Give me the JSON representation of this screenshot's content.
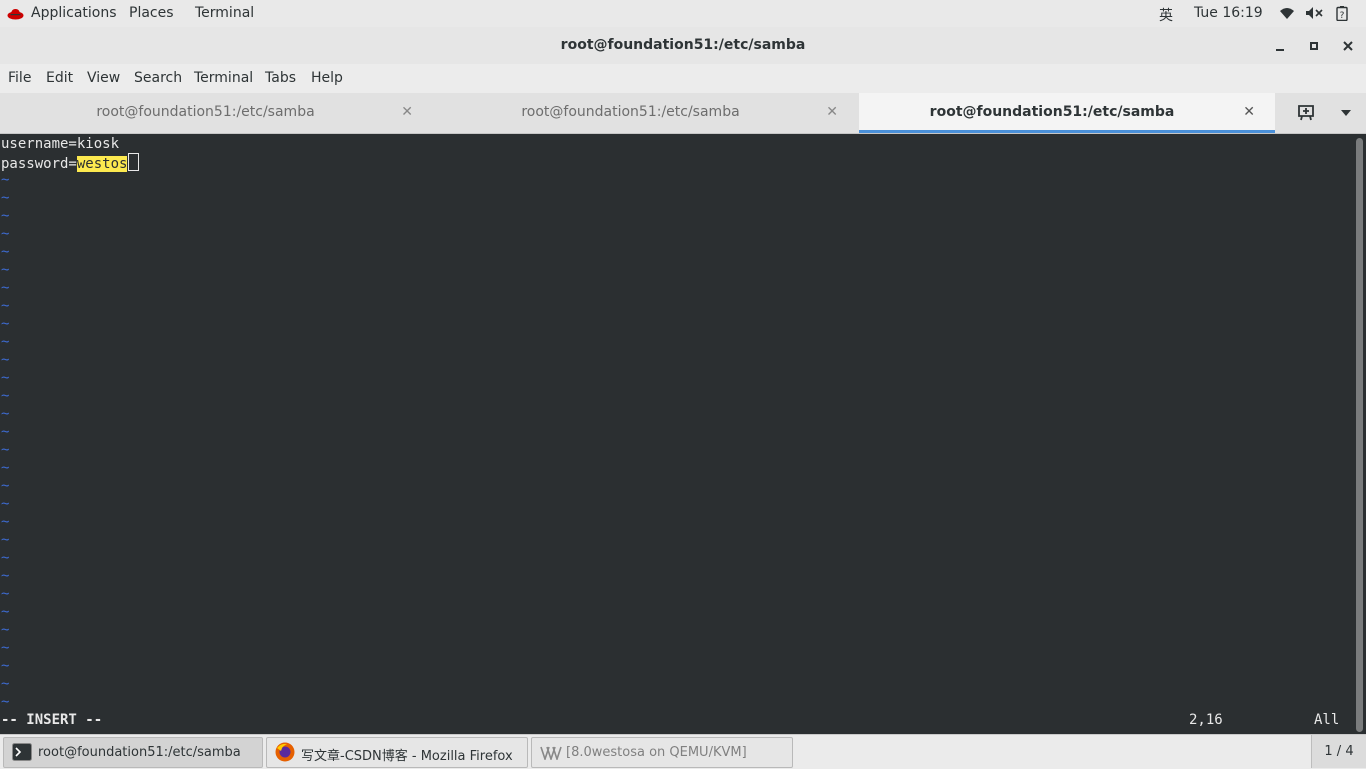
{
  "topbar": {
    "applications": "Applications",
    "places": "Places",
    "terminal": "Terminal",
    "input_method": "英",
    "clock": "Tue 16:19"
  },
  "window": {
    "title": "root@foundation51:/etc/samba"
  },
  "menubar": {
    "items": [
      "File",
      "Edit",
      "View",
      "Search",
      "Terminal",
      "Tabs",
      "Help"
    ]
  },
  "tabs": [
    {
      "label": "root@foundation51:/etc/samba",
      "active": false
    },
    {
      "label": "root@foundation51:/etc/samba",
      "active": false
    },
    {
      "label": "root@foundation51:/etc/samba",
      "active": true
    }
  ],
  "terminal": {
    "line1": "username=kiosk",
    "line2_prefix": "password=",
    "line2_highlight": "westos",
    "tilde": "~",
    "mode": "-- INSERT --",
    "position": "2,16",
    "scroll": "All"
  },
  "taskbar": {
    "items": [
      {
        "label": "root@foundation51:/etc/samba",
        "icon": "terminal-icon"
      },
      {
        "label": "写文章-CSDN博客 - Mozilla Firefox",
        "icon": "firefox-icon"
      },
      {
        "label": "[8.0westosa on QEMU/KVM]",
        "icon": "virt-manager-icon"
      }
    ],
    "workspace": "1 / 4"
  },
  "colors": {
    "terminal_bg": "#2b2f31",
    "highlight": "#fce94f",
    "tilde": "#3d6bd1",
    "active_tab_underline": "#4a90d9"
  }
}
